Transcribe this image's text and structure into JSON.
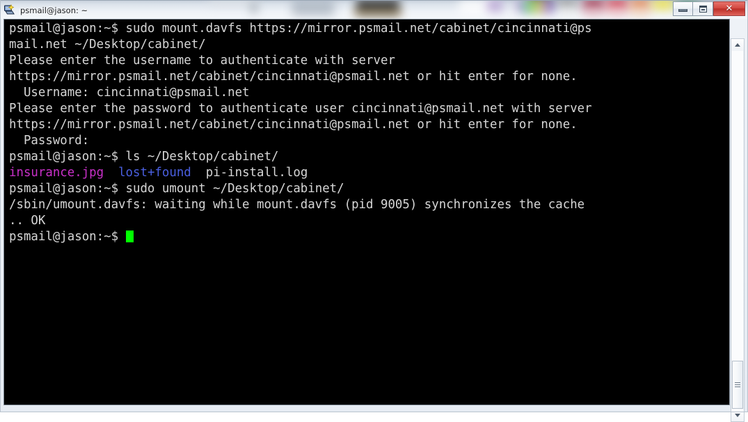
{
  "window": {
    "title": "psmail@jason: ~",
    "icon": "putty-terminal-icon",
    "controls": {
      "minimize_label": "–",
      "maximize_label": "□",
      "close_label": "✕"
    }
  },
  "terminal": {
    "background_color": "#000000",
    "foreground_color": "#d6d6d6",
    "cursor_color": "#00ff00",
    "colors": {
      "magenta": "#c930c9",
      "blue": "#4a5fe0",
      "default": "#d6d6d6"
    },
    "lines": [
      {
        "id": "line-01",
        "segments": [
          {
            "text": "psmail@jason:~$ sudo mount.davfs https://mirror.psmail.net/cabinet/cincinnati@ps",
            "color": "default"
          }
        ]
      },
      {
        "id": "line-02",
        "segments": [
          {
            "text": "mail.net ~/Desktop/cabinet/",
            "color": "default"
          }
        ]
      },
      {
        "id": "line-03",
        "segments": [
          {
            "text": "Please enter the username to authenticate with server",
            "color": "default"
          }
        ]
      },
      {
        "id": "line-04",
        "segments": [
          {
            "text": "https://mirror.psmail.net/cabinet/cincinnati@psmail.net or hit enter for none.",
            "color": "default"
          }
        ]
      },
      {
        "id": "line-05",
        "segments": [
          {
            "text": "  Username: cincinnati@psmail.net",
            "color": "default"
          }
        ]
      },
      {
        "id": "line-06",
        "segments": [
          {
            "text": "Please enter the password to authenticate user cincinnati@psmail.net with server",
            "color": "default"
          }
        ]
      },
      {
        "id": "line-07",
        "segments": [
          {
            "text": "https://mirror.psmail.net/cabinet/cincinnati@psmail.net or hit enter for none.",
            "color": "default"
          }
        ]
      },
      {
        "id": "line-08",
        "segments": [
          {
            "text": "  Password:",
            "color": "default"
          }
        ]
      },
      {
        "id": "line-09",
        "segments": [
          {
            "text": "psmail@jason:~$ ls ~/Desktop/cabinet/",
            "color": "default"
          }
        ]
      },
      {
        "id": "line-10",
        "segments": [
          {
            "text": "insurance.jpg",
            "color": "magenta"
          },
          {
            "text": "  ",
            "color": "default"
          },
          {
            "text": "lost+found",
            "color": "blue"
          },
          {
            "text": "  pi-install.log",
            "color": "default"
          }
        ]
      },
      {
        "id": "line-11",
        "segments": [
          {
            "text": "psmail@jason:~$ sudo umount ~/Desktop/cabinet/",
            "color": "default"
          }
        ]
      },
      {
        "id": "line-12",
        "segments": [
          {
            "text": "/sbin/umount.davfs: waiting while mount.davfs (pid 9005) synchronizes the cache",
            "color": "default"
          }
        ]
      },
      {
        "id": "line-13",
        "segments": [
          {
            "text": ".. OK",
            "color": "default"
          }
        ]
      },
      {
        "id": "line-14",
        "segments": [
          {
            "text": "psmail@jason:~$ ",
            "color": "default"
          },
          {
            "text": "",
            "cursor": true
          }
        ]
      }
    ]
  },
  "scrollbar": {
    "up_arrow": "scroll-up",
    "down_arrow": "scroll-down",
    "thumb_position_percent": 84
  }
}
